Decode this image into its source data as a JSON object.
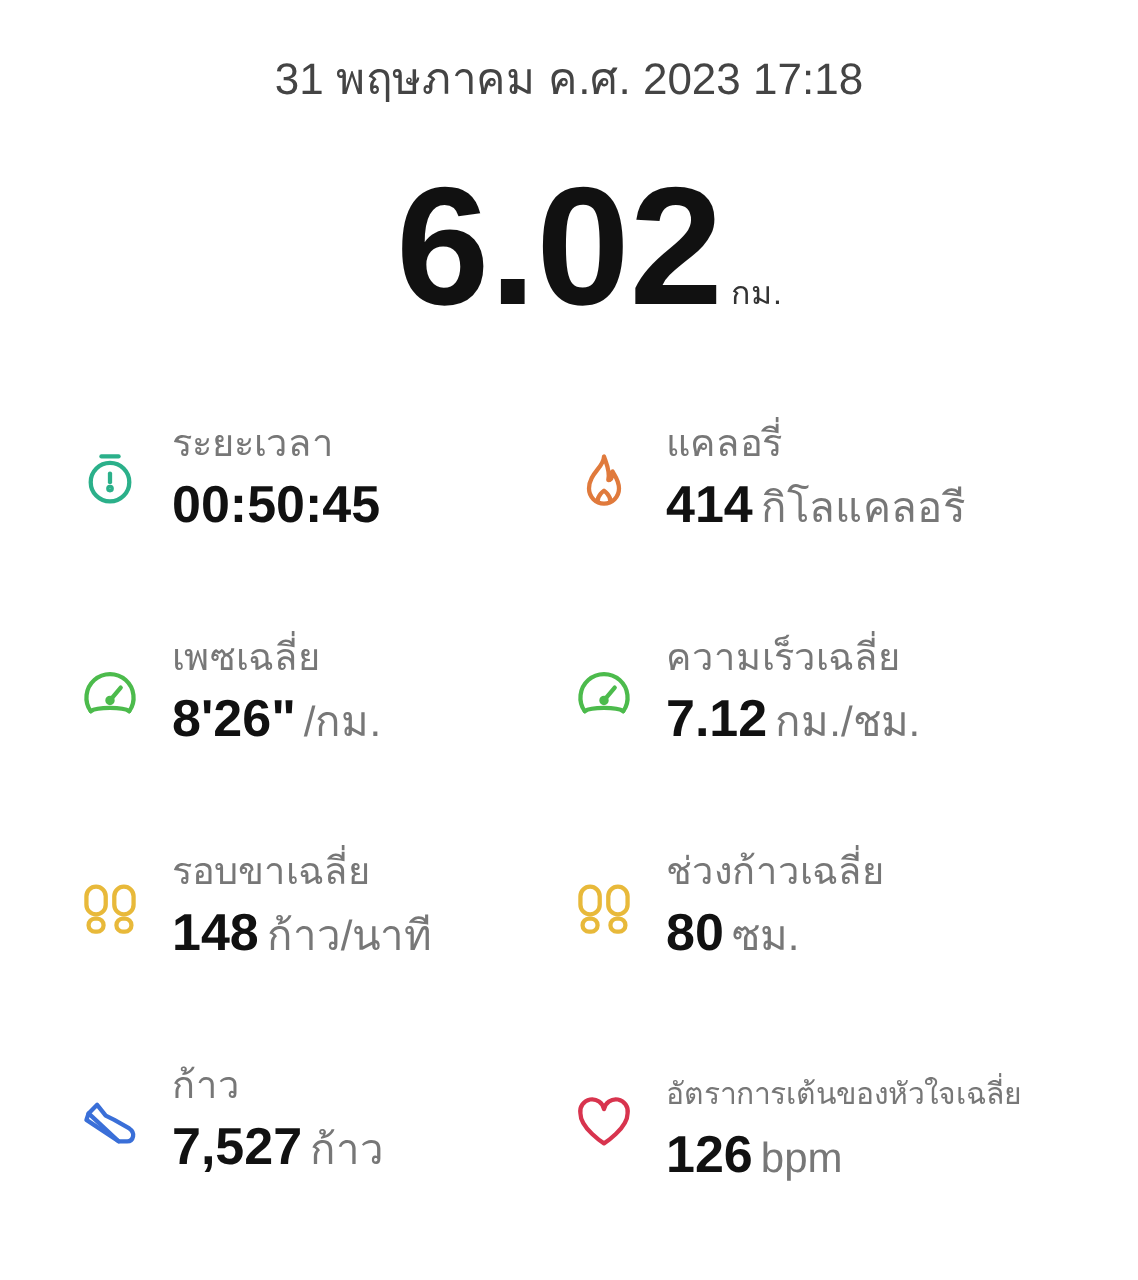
{
  "date": "31 พฤษภาคม ค.ศ. 2023 17:18",
  "distance": {
    "value": "6.02",
    "unit": "กม."
  },
  "stats": [
    {
      "kind": "stopwatch",
      "label": "ระยะเวลา",
      "value": "00:50:45"
    },
    {
      "kind": "flame",
      "label": "แคลอรี่",
      "value": "414",
      "unit": "กิโลแคลอรี"
    },
    {
      "kind": "gauge",
      "label": "เพซเฉลี่ย",
      "value": "8'26\"",
      "unit": "/กม."
    },
    {
      "kind": "gauge",
      "label": "ความเร็วเฉลี่ย",
      "value": "7.12",
      "unit": "กม./ชม."
    },
    {
      "kind": "footprints",
      "label": "รอบขาเฉลี่ย",
      "value": "148",
      "unit": "ก้าว/นาที"
    },
    {
      "kind": "footprints",
      "label": "ช่วงก้าวเฉลี่ย",
      "value": "80",
      "unit": "ซม."
    },
    {
      "kind": "shoe",
      "label": "ก้าว",
      "value": "7,527",
      "unit": "ก้าว"
    },
    {
      "kind": "heart",
      "label": "อัตราการเต้นของหัวใจเฉลี่ย",
      "value": "126",
      "unit": "bpm",
      "small_label": true
    }
  ]
}
